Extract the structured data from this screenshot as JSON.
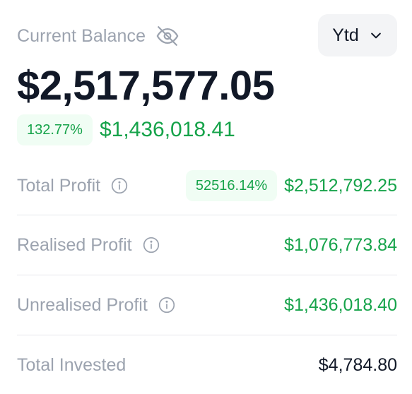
{
  "header": {
    "balance_label": "Current Balance",
    "period": "Ytd",
    "visibility_icon": "eye-off-icon",
    "period_icon": "chevron-down-icon"
  },
  "balance": {
    "value": "$2,517,577.05",
    "change_percent": "132.77%",
    "change_amount": "$1,436,018.41"
  },
  "rows": [
    {
      "label": "Total Profit",
      "badge": "52516.14%",
      "value": "$2,512,792.25",
      "has_info": true
    },
    {
      "label": "Realised Profit",
      "value": "$1,076,773.84",
      "has_info": true
    },
    {
      "label": "Unrealised Profit",
      "value": "$1,436,018.40",
      "has_info": true
    },
    {
      "label": "Total Invested",
      "value": "$4,784.80",
      "has_info": false
    }
  ],
  "colors": {
    "positive": "#16a34a",
    "positive_bg": "#f0fdf4",
    "muted": "#9ca3af",
    "text": "#111827",
    "divider": "#e5e7eb"
  }
}
